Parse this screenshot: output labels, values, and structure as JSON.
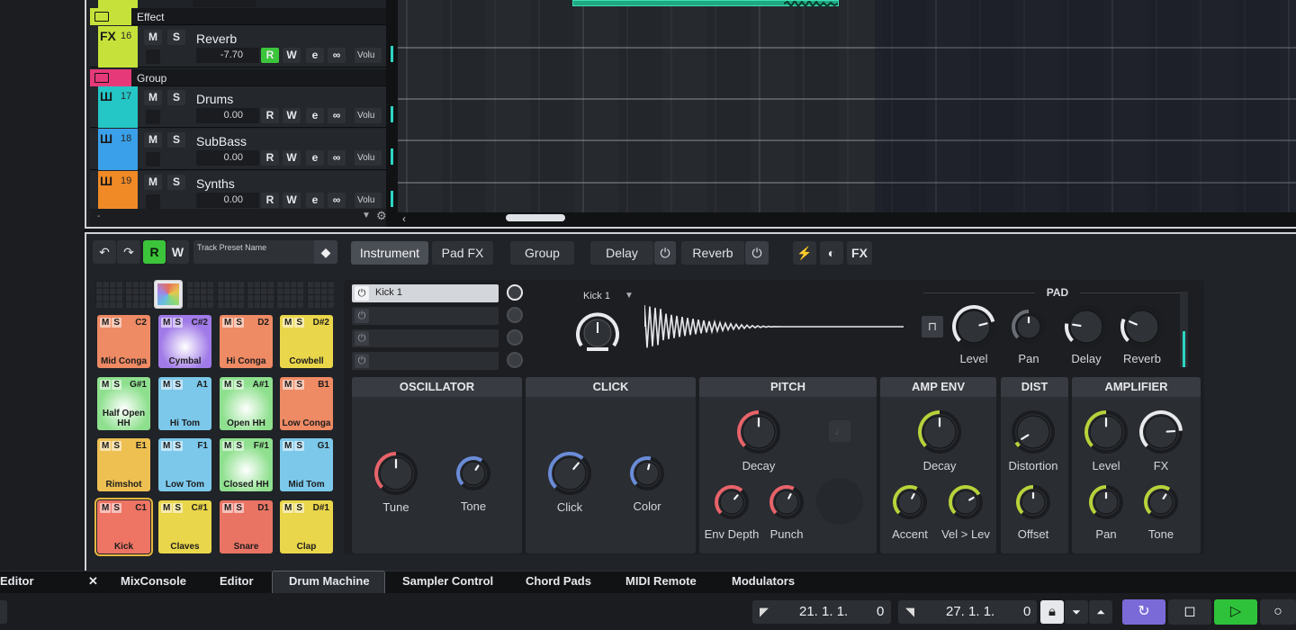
{
  "tracks": {
    "folders": [
      {
        "name": "Effect",
        "color": "#c6e23a"
      },
      {
        "name": "Group",
        "color": "#e6397a"
      }
    ],
    "items": [
      {
        "icon": "FX",
        "num": "16",
        "name": "Reverb",
        "vol": "-7.70",
        "color": "#c6e23a",
        "read_on": true
      },
      {
        "icon": "Ш",
        "num": "17",
        "name": "Drums",
        "vol": "0.00",
        "color": "#24c6c6",
        "read_on": false
      },
      {
        "icon": "Ш",
        "num": "18",
        "name": "SubBass",
        "vol": "0.00",
        "color": "#3aa0ea",
        "read_on": false
      },
      {
        "icon": "Ш",
        "num": "19",
        "name": "Synths",
        "vol": "0.00",
        "color": "#f08a26",
        "read_on": false
      }
    ],
    "btn_m": "M",
    "btn_s": "S",
    "btn_r": "R",
    "btn_w": "W",
    "btn_e": "e",
    "btn_link": "∞",
    "vol_label": "Volu"
  },
  "toolbar": {
    "undo": "↶",
    "redo": "↷",
    "read": "R",
    "write": "W",
    "preset_name": "Track Preset Name",
    "tabs": {
      "instrument": "Instrument",
      "padfx": "Pad FX",
      "group": "Group",
      "delay": "Delay",
      "reverb": "Reverb",
      "fx": "FX"
    }
  },
  "pads": [
    {
      "name": "Mid Conga",
      "note": "C2",
      "color": "#ee8a64"
    },
    {
      "name": "Cymbal",
      "note": "C#2",
      "color": "#a07ae8"
    },
    {
      "name": "Hi Conga",
      "note": "D2",
      "color": "#ee8a64"
    },
    {
      "name": "Cowbell",
      "note": "D#2",
      "color": "#ead64a"
    },
    {
      "name": "Half Open HH",
      "note": "G#1",
      "color": "#8ee08e"
    },
    {
      "name": "Hi Tom",
      "note": "A1",
      "color": "#7cc8ea"
    },
    {
      "name": "Open HH",
      "note": "A#1",
      "color": "#8ee08e"
    },
    {
      "name": "Low Conga",
      "note": "B1",
      "color": "#ee8a64"
    },
    {
      "name": "Rimshot",
      "note": "E1",
      "color": "#eec052"
    },
    {
      "name": "Low Tom",
      "note": "F1",
      "color": "#7cc8ea"
    },
    {
      "name": "Closed HH",
      "note": "F#1",
      "color": "#8ee08e"
    },
    {
      "name": "Mid Tom",
      "note": "G1",
      "color": "#7cc8ea"
    },
    {
      "name": "Kick",
      "note": "C1",
      "color": "#ee7464"
    },
    {
      "name": "Claves",
      "note": "C#1",
      "color": "#ead64a"
    },
    {
      "name": "Snare",
      "note": "D1",
      "color": "#ea7464"
    },
    {
      "name": "Clap",
      "note": "D#1",
      "color": "#ead64a"
    }
  ],
  "layers": {
    "items": [
      "Kick 1",
      "",
      "",
      ""
    ],
    "sample_name": "Kick 1"
  },
  "pad_section": {
    "title": "PAD",
    "knobs": [
      {
        "label": "Level",
        "value": 0.78
      },
      {
        "label": "Pan",
        "value": 0.5
      },
      {
        "label": "Delay",
        "value": 0.2
      },
      {
        "label": "Reverb",
        "value": 0.25
      }
    ]
  },
  "sections": {
    "oscillator": {
      "title": "OSCILLATOR",
      "knobs": [
        {
          "label": "Tune",
          "value": 0.5
        },
        {
          "label": "Tone",
          "value": 0.62
        }
      ]
    },
    "click": {
      "title": "CLICK",
      "knobs": [
        {
          "label": "Click",
          "value": 0.65
        },
        {
          "label": "Color",
          "value": 0.55
        }
      ]
    },
    "pitch": {
      "title": "PITCH",
      "knobs": [
        {
          "label": "Decay",
          "value": 0.5
        },
        {
          "label": "Env Depth",
          "value": 0.65
        },
        {
          "label": "Punch",
          "value": 0.6
        }
      ]
    },
    "ampenv": {
      "title": "AMP ENV",
      "knobs": [
        {
          "label": "Decay",
          "value": 0.5
        },
        {
          "label": "Accent",
          "value": 0.6
        },
        {
          "label": "Vel > Lev",
          "value": 0.72
        }
      ]
    },
    "dist": {
      "title": "DIST",
      "knobs": [
        {
          "label": "Distortion",
          "value": 0.05
        },
        {
          "label": "Offset",
          "value": 0.5
        }
      ]
    },
    "amplifier": {
      "title": "AMPLIFIER",
      "knobs": [
        {
          "label": "Level",
          "value": 0.5
        },
        {
          "label": "FX",
          "value": 0.82
        },
        {
          "label": "Pan",
          "value": 0.5
        },
        {
          "label": "Tone",
          "value": 0.62
        }
      ]
    }
  },
  "bottom_tabs": {
    "editor_left": "Editor",
    "close": "✕",
    "mixconsole": "MixConsole",
    "editor": "Editor",
    "drum_machine": "Drum Machine",
    "sampler_control": "Sampler Control",
    "chord_pads": "Chord Pads",
    "midi_remote": "MIDI Remote",
    "modulators": "Modulators"
  },
  "transport": {
    "left_locator": "21. 1. 1.",
    "left_ticks": "0",
    "right_locator": "27. 1. 1.",
    "right_ticks": "0"
  }
}
